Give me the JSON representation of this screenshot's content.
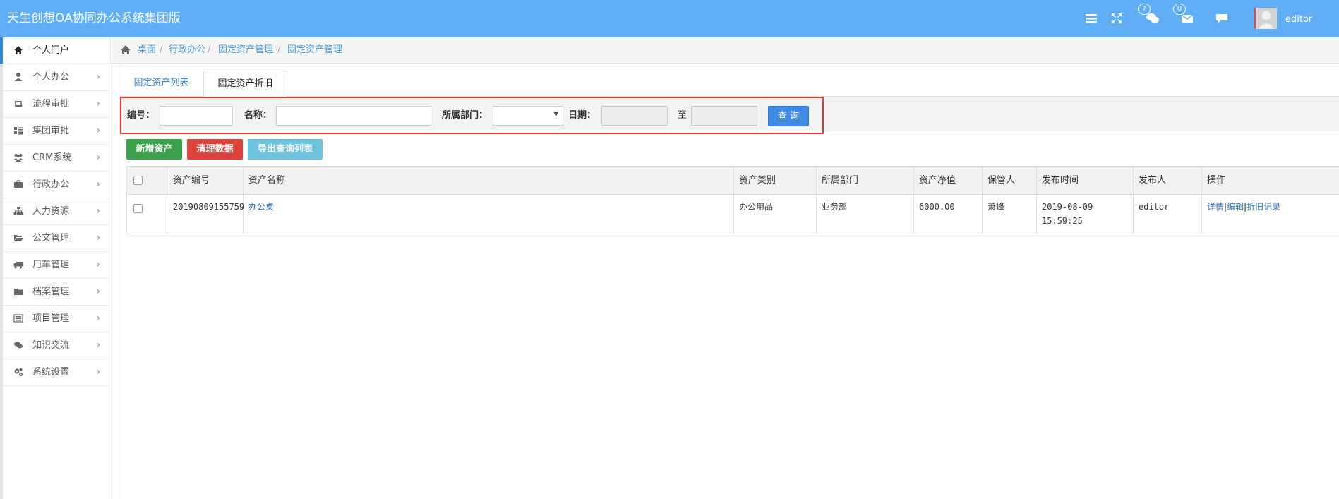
{
  "app": {
    "title": "天生创想OA协同办公系统集团版"
  },
  "header": {
    "chat_badge": "7",
    "mail_badge": "0",
    "username": "editor",
    "icons": [
      "menu-icon",
      "fullscreen-icon",
      "chat-icon",
      "mail-icon",
      "message-icon",
      "avatar"
    ]
  },
  "sidebar": {
    "items": [
      {
        "label": "个人门户",
        "icon": "home-icon",
        "active": true
      },
      {
        "label": "个人办公",
        "icon": "user-icon"
      },
      {
        "label": "流程审批",
        "icon": "retweet-icon"
      },
      {
        "label": "集团审批",
        "icon": "list-icon"
      },
      {
        "label": "CRM系统",
        "icon": "group-icon"
      },
      {
        "label": "行政办公",
        "icon": "briefcase-icon"
      },
      {
        "label": "人力资源",
        "icon": "sitemap-icon"
      },
      {
        "label": "公文管理",
        "icon": "folder-open-icon"
      },
      {
        "label": "用车管理",
        "icon": "truck-icon"
      },
      {
        "label": "档案管理",
        "icon": "folder-icon"
      },
      {
        "label": "项目管理",
        "icon": "tasks-icon"
      },
      {
        "label": "知识交流",
        "icon": "comments-icon"
      },
      {
        "label": "系统设置",
        "icon": "cogs-icon"
      }
    ]
  },
  "breadcrumb": [
    "桌面",
    "行政办公",
    "固定资产管理",
    "固定资产管理"
  ],
  "tabs": [
    {
      "label": "固定资产列表",
      "active": false
    },
    {
      "label": "固定资产折旧",
      "active": true
    }
  ],
  "filter": {
    "code_label": "编号：",
    "code_value": "",
    "name_label": "名称：",
    "name_value": "",
    "dept_label": "所属部门：",
    "dept_value": "",
    "date_label": "日期：",
    "date_from": "",
    "to_label": "至",
    "date_to": "",
    "search_label": "查 询"
  },
  "actions": {
    "add_label": "新增资产",
    "clear_label": "清理数据",
    "export_label": "导出查询列表"
  },
  "table": {
    "headers": [
      "资产编号",
      "资产名称",
      "资产类别",
      "所属部门",
      "资产净值",
      "保管人",
      "发布时间",
      "发布人",
      "操作"
    ],
    "rows": [
      {
        "code": "20190809155759",
        "name": "办公桌",
        "category": "办公用品",
        "dept": "业务部",
        "net_value": "6000.00",
        "keeper": "萧峰",
        "date": "2019-08-09",
        "time": "15:59:25",
        "publisher": "editor",
        "op_detail": "详情",
        "op_edit": "编辑",
        "op_depr": "折旧记录",
        "op_sep": "|"
      }
    ]
  },
  "colors": {
    "topbar": "#60aef5",
    "green": "#3aa24a",
    "red": "#d9433a",
    "cyan": "#6cc3e0",
    "primary": "#3f8be6",
    "highlight": "#e53935"
  }
}
